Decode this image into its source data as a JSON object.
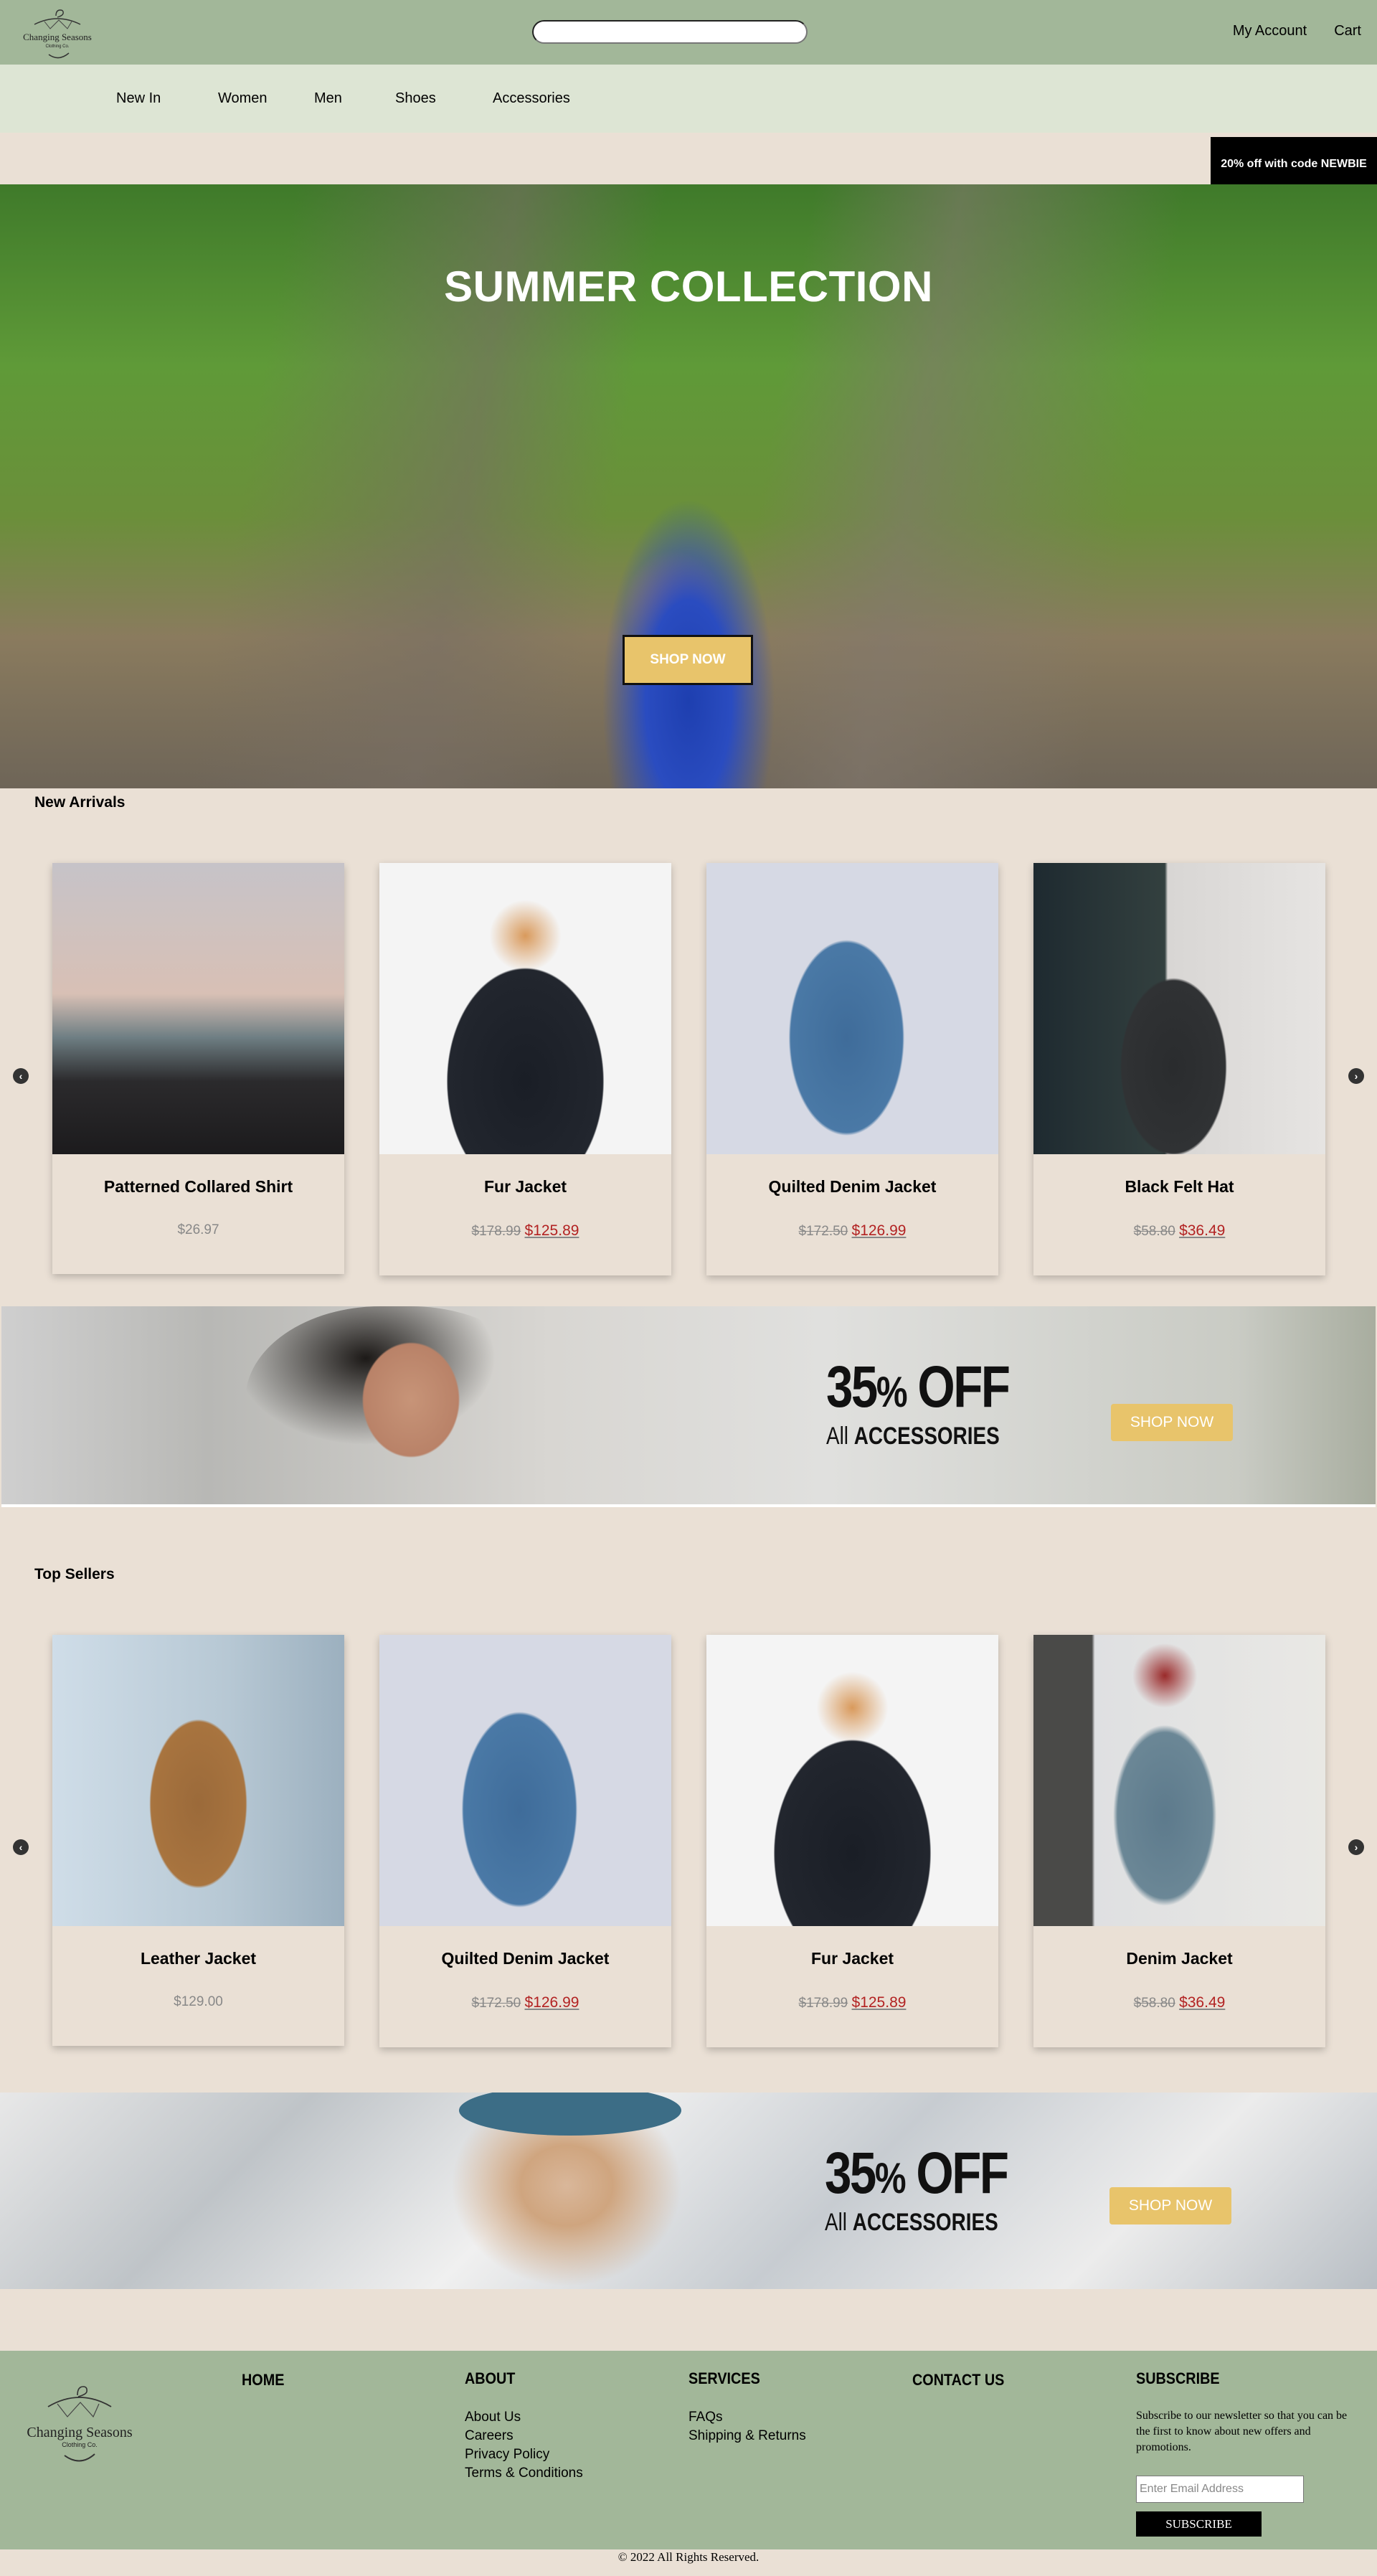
{
  "header": {
    "logo": {
      "name": "Changing Seasons",
      "tagline": "Clothing Co."
    },
    "search_placeholder": "",
    "links": [
      "My Account",
      "Cart"
    ]
  },
  "nav": {
    "items": [
      "New In",
      "Women",
      "Men",
      "Shoes",
      "Accessories"
    ]
  },
  "promo_code": "20% off with code NEWBIE",
  "hero": {
    "title": "SUMMER COLLECTION",
    "button": "SHOP NOW"
  },
  "new_arrivals": {
    "title": "New Arrivals",
    "products": [
      {
        "name": "Patterned Collared Shirt",
        "price": "$26.97",
        "old_price": null,
        "sale_price": null
      },
      {
        "name": "Fur Jacket",
        "price": null,
        "old_price": "$178.99",
        "sale_price": "$125.89"
      },
      {
        "name": "Quilted Denim Jacket",
        "price": null,
        "old_price": "$172.50",
        "sale_price": "$126.99"
      },
      {
        "name": "Black Felt Hat",
        "price": null,
        "old_price": "$58.80",
        "sale_price": "$36.49"
      }
    ]
  },
  "banner1": {
    "headline_num": "35",
    "headline_pct": "%",
    "headline_off": " OFF",
    "sub_thin": "All ",
    "sub_bold": "ACCESSORIES",
    "button": "SHOP NOW"
  },
  "top_sellers": {
    "title": "Top Sellers",
    "products": [
      {
        "name": "Leather Jacket",
        "price": "$129.00",
        "old_price": null,
        "sale_price": null
      },
      {
        "name": "Quilted Denim Jacket",
        "price": null,
        "old_price": "$172.50",
        "sale_price": "$126.99"
      },
      {
        "name": "Fur Jacket",
        "price": null,
        "old_price": "$178.99",
        "sale_price": "$125.89"
      },
      {
        "name": "Denim Jacket",
        "price": null,
        "old_price": "$58.80",
        "sale_price": "$36.49"
      }
    ]
  },
  "banner2": {
    "headline_num": "35",
    "headline_pct": "%",
    "headline_off": " OFF",
    "sub_thin": "All ",
    "sub_bold": "ACCESSORIES",
    "button": "SHOP NOW"
  },
  "carousel": {
    "prev_icon": "‹",
    "next_icon": "›"
  },
  "footer": {
    "home": "HOME",
    "about": {
      "title": "ABOUT",
      "links": [
        "About Us",
        "Careers",
        "Privacy Policy",
        "Terms & Conditions"
      ]
    },
    "services": {
      "title": "SERVICES",
      "links": [
        "FAQs",
        "Shipping & Returns"
      ]
    },
    "contact": "CONTACT US",
    "subscribe": {
      "title": "SUBSCRIBE",
      "text": "Subscribe to our newsletter so that you can be the first to know about new offers and promotions.",
      "email_placeholder": "Enter Email Address",
      "button": "SUBSCRIBE"
    },
    "copyright": "© 2022 All Rights Reserved."
  },
  "colors": {
    "header_green": "#a2b799",
    "nav_green": "#dde5d4",
    "page_beige": "#eae0d5",
    "gold": "#e8c46b",
    "sale_red": "#b22222"
  }
}
